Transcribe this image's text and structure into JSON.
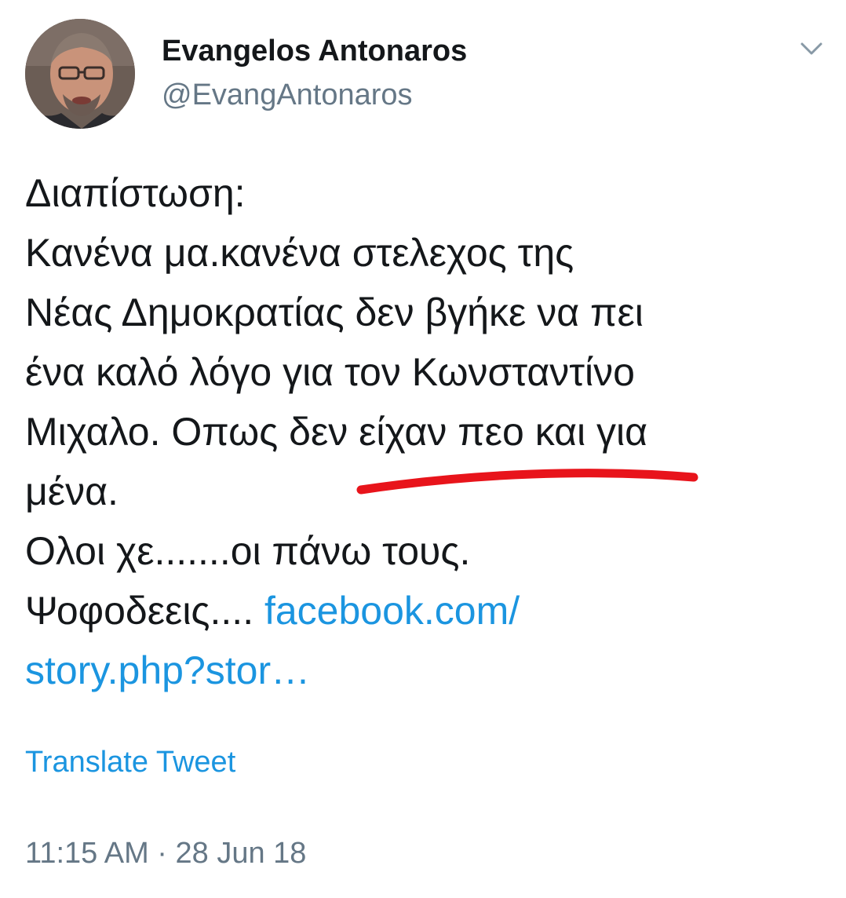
{
  "author": {
    "display_name": "Evangelos Antonaros",
    "handle": "@EvangAntonaros",
    "avatar_icon": "profile-photo"
  },
  "menu": {
    "icon": "chevron-down-icon"
  },
  "tweet": {
    "lines": [
      "Διαπίστωση:",
      "Κανένα μα.κανένα στελεχος της",
      "Νέας Δημοκρατίας δεν βγήκε να πει",
      "ένα καλό λόγο για τον Κωνσταντίνο",
      "Μιχαλο. Οπως δεν είχαν πεο και για",
      "μένα.",
      "Ολοι χε.......οι πάνω τους."
    ],
    "last_line_prefix": "Ψοφοδεεις.... ",
    "link_part1": "facebook.com/",
    "link_part2": "story.php?stor…"
  },
  "annotation": {
    "color": "#e8141b"
  },
  "translate_label": "Translate Tweet",
  "timestamp": "11:15 AM · 28 Jun 18",
  "colors": {
    "text": "#14171a",
    "secondary": "#657786",
    "link": "#1b95e0"
  }
}
